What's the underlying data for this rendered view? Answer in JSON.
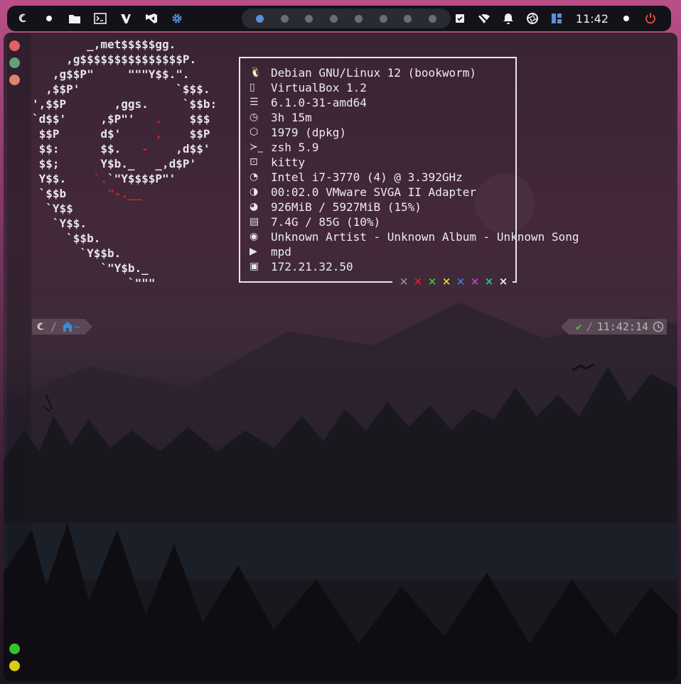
{
  "topbar": {
    "launcher_icon": "debian-swirl-icon",
    "left_icons": [
      "dot-icon",
      "folder-icon",
      "terminal-icon",
      "vim-icon",
      "vscode-icon",
      "gear-icon"
    ],
    "workspaces": [
      true,
      false,
      false,
      false,
      false,
      false,
      false,
      false
    ],
    "right_icons": [
      "checkbox-icon",
      "wifi-off-icon",
      "bell-icon",
      "camera-shutter-icon",
      "layout-icon"
    ],
    "clock": "11:42",
    "power_icon": "power-icon"
  },
  "ascii_lines": [
    "        _,met$$$$$gg.",
    "     ,g$$$$$$$$$$$$$$$P.",
    "   ,g$$P\"     \"\"\"Y$$.\".",
    "  ,$$P'              `$$$.",
    "',$$P       ,ggs.     `$$b:",
    "`d$$'     ,$P\"'   <r>.</r>    $$$",
    " $$P      d$'     <r>,</r>    $$P",
    " $$:      $$.   <r>-</r>    ,d$$'",
    " $$;      Y$b._   _,d$P'",
    " Y$$.    <r>`.</r>`\"Y$$$$P\"'",
    " `$$b      <r>\"-.__</r>",
    "  `Y$$",
    "   `Y$$.",
    "     `$$b.",
    "       `Y$$b.",
    "          `\"Y$b._",
    "              `\"\"\""
  ],
  "info": [
    {
      "icon": "linux-icon",
      "glyph": "🐧",
      "text": "Debian GNU/Linux 12 (bookworm)"
    },
    {
      "icon": "host-icon",
      "glyph": "▯",
      "text": "VirtualBox 1.2"
    },
    {
      "icon": "kernel-icon",
      "glyph": "☰",
      "text": "6.1.0-31-amd64"
    },
    {
      "icon": "clock-icon",
      "glyph": "◷",
      "text": "3h 15m"
    },
    {
      "icon": "package-icon",
      "glyph": "⬡",
      "text": "1979 (dpkg)"
    },
    {
      "icon": "shell-icon",
      "glyph": "≻_",
      "text": "zsh 5.9"
    },
    {
      "icon": "terminal-icon",
      "glyph": "⊡",
      "text": "kitty"
    },
    {
      "icon": "cpu-icon",
      "glyph": "◔",
      "text": "Intel i7-3770 (4) @ 3.392GHz"
    },
    {
      "icon": "gpu-icon",
      "glyph": "◑",
      "text": "00:02.0 VMware SVGA II Adapter"
    },
    {
      "icon": "memory-icon",
      "glyph": "◕",
      "text": "926MiB / 5927MiB (15%)"
    },
    {
      "icon": "disk-icon",
      "glyph": "▤",
      "text": "7.4G / 85G (10%)"
    },
    {
      "icon": "spotify-icon",
      "glyph": "◉",
      "text": "Unknown Artist - Unknown Album - Unknown Song"
    },
    {
      "icon": "play-icon",
      "glyph": "▶",
      "text": "mpd"
    },
    {
      "icon": "network-icon",
      "glyph": "▣",
      "text": "172.21.32.50"
    }
  ],
  "color_marks": [
    {
      "char": "×",
      "color": "#8a8a8a"
    },
    {
      "char": "×",
      "color": "#d81f2b"
    },
    {
      "char": "×",
      "color": "#3fbf3f"
    },
    {
      "char": "×",
      "color": "#d8d830"
    },
    {
      "char": "×",
      "color": "#4878d8"
    },
    {
      "char": "×",
      "color": "#c83cc8"
    },
    {
      "char": "×",
      "color": "#30b8b8"
    },
    {
      "char": "×",
      "color": "#f0f0f0"
    }
  ],
  "prompt": {
    "os_icon": "debian-swirl-icon",
    "home_icon": "home-icon",
    "path": "~",
    "status_check": "✔",
    "time": "11:42:14",
    "time_icon": "clock-icon"
  },
  "window_dots": [
    "#e06262",
    "#62a07a",
    "#e08272"
  ],
  "bottom_dots": [
    "#36c02c",
    "#d8cc14"
  ]
}
